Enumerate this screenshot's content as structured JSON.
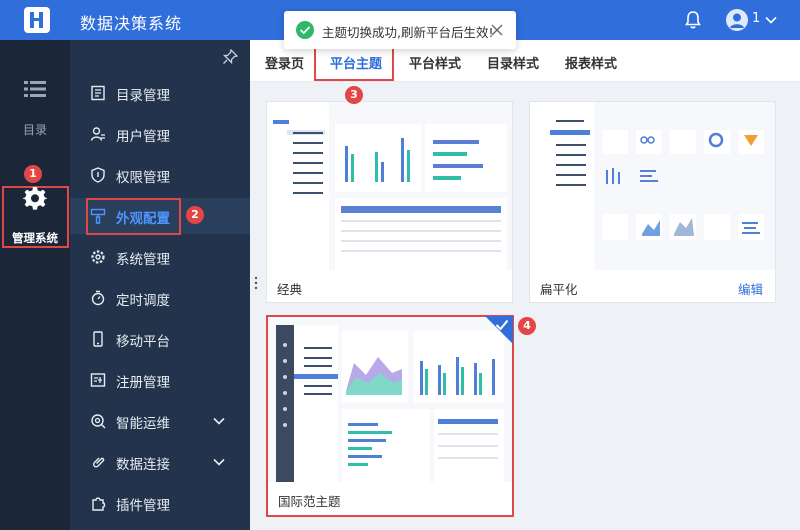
{
  "header": {
    "app_title": "数据决策系统",
    "user_name": "1",
    "icons": [
      "app-logo",
      "bell-icon",
      "user-avatar-icon",
      "chevron-down-icon"
    ]
  },
  "toast": {
    "message": "主题切换成功,刷新平台后生效!",
    "icon": "check-circle-icon",
    "close_icon": "close-icon"
  },
  "rail": {
    "items": [
      {
        "label": "目录",
        "icon": "list-icon",
        "active": false
      },
      {
        "label": "管理系统",
        "icon": "gear-icon",
        "active": true
      }
    ]
  },
  "sidebar": {
    "pin_icon": "pin-icon",
    "items": [
      {
        "label": "目录管理",
        "icon": "catalog-icon"
      },
      {
        "label": "用户管理",
        "icon": "user-icon"
      },
      {
        "label": "权限管理",
        "icon": "shield-icon"
      },
      {
        "label": "外观配置",
        "icon": "brush-icon",
        "active": true
      },
      {
        "label": "系统管理",
        "icon": "gear-icon"
      },
      {
        "label": "定时调度",
        "icon": "stopwatch-icon"
      },
      {
        "label": "移动平台",
        "icon": "mobile-icon"
      },
      {
        "label": "注册管理",
        "icon": "register-icon"
      },
      {
        "label": "智能运维",
        "icon": "ops-icon",
        "expandable": true
      },
      {
        "label": "数据连接",
        "icon": "link-icon",
        "expandable": true
      },
      {
        "label": "插件管理",
        "icon": "plugin-icon"
      }
    ]
  },
  "tabs": [
    {
      "label": "登录页",
      "active": false
    },
    {
      "label": "平台主题",
      "active": true
    },
    {
      "label": "平台样式",
      "active": false
    },
    {
      "label": "目录样式",
      "active": false
    },
    {
      "label": "报表样式",
      "active": false
    }
  ],
  "themes": [
    {
      "label": "经典",
      "edit": ""
    },
    {
      "label": "扁平化",
      "edit": "编辑"
    },
    {
      "label": "国际范主题",
      "edit": "",
      "selected": true
    }
  ],
  "badges": [
    "1",
    "2",
    "3",
    "4"
  ],
  "colors": {
    "brand": "#2f6edb",
    "rail_bg": "#1b2738",
    "sidebar_bg": "#22334b",
    "highlight_red": "#e04848",
    "success": "#2fb868"
  }
}
